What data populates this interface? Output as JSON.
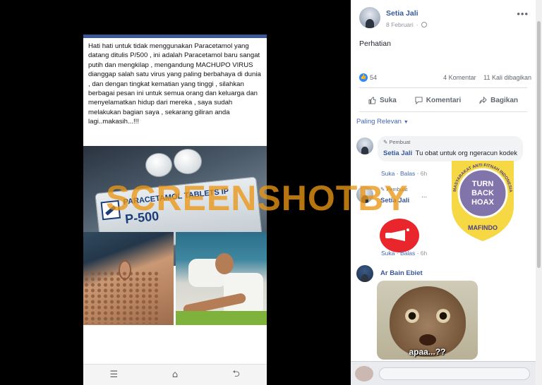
{
  "warning_text": "Hati hati untuk tidak menggunakan Paracetamol yang datang ditulis P/500 , ini adalah Paracetamol baru sangat putih dan mengkilap , mengandung MACHUPO VIRUS dianggap salah satu virus yang paling berbahaya di dunia , dan dengan tingkat kematian yang tinggi , silahkan berbagai pesan ini untuk semua orang dan keluarga dan menyelamatkan hidup dari mereka , saya sudah melakukan bagian saya , sekarang giliran anda lagi..makasih...!!!",
  "pill_pack": {
    "brand": "PARACETAMOL TABLETS IP",
    "dose": "P-500"
  },
  "watermark": "SCREENSHOTBY",
  "nav": {
    "recent": "☰",
    "home": "⌂",
    "back": "⮌"
  },
  "post": {
    "author": "Setia Jali",
    "date": "8 Februari",
    "more": "•••",
    "text": "Perhatian",
    "like_count": "54",
    "comments": "4 Komentar",
    "shares": "11 Kali dibagikan"
  },
  "actions": {
    "like": "Suka",
    "comment": "Komentari",
    "share": "Bagikan"
  },
  "relevance": "Paling Relevan",
  "comments": [
    {
      "badge": "Pembuat",
      "author": "Setia Jali",
      "text": "Tu obat untuk org ngeracun kodek",
      "like": "Suka",
      "reply": "Balas",
      "time": "6h"
    },
    {
      "badge": "Pembuat",
      "author": "Setia Jali",
      "dots": "...",
      "like": "Suka",
      "reply": "Balas",
      "time": "6h"
    },
    {
      "author": "Ar Bain Ebiet",
      "caption": "apaa...??"
    }
  ],
  "hoax_badge": {
    "arc_text": "MASYARAKAT ANTI FITNAH INDONESIA",
    "line1": "TURN",
    "line2": "BACK",
    "line3": "HOAX",
    "bottom": "MAFINDO"
  },
  "colors": {
    "facebook_blue": "#365899",
    "link_blue": "#4267b2",
    "watermark": "#eb9614",
    "hoax_yellow": "#f5d330",
    "hoax_purple": "#7a6fb0"
  }
}
